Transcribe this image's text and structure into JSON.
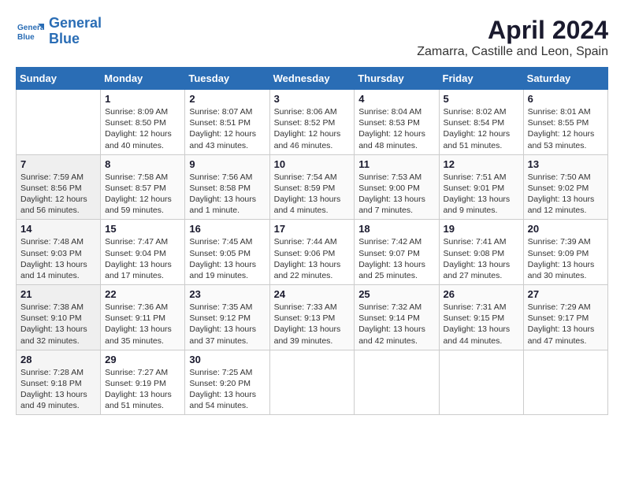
{
  "logo": {
    "line1": "General",
    "line2": "Blue"
  },
  "title": "April 2024",
  "subtitle": "Zamarra, Castille and Leon, Spain",
  "weekdays": [
    "Sunday",
    "Monday",
    "Tuesday",
    "Wednesday",
    "Thursday",
    "Friday",
    "Saturday"
  ],
  "weeks": [
    [
      {
        "day": "",
        "sunrise": "",
        "sunset": "",
        "daylight": ""
      },
      {
        "day": "1",
        "sunrise": "Sunrise: 8:09 AM",
        "sunset": "Sunset: 8:50 PM",
        "daylight": "Daylight: 12 hours and 40 minutes."
      },
      {
        "day": "2",
        "sunrise": "Sunrise: 8:07 AM",
        "sunset": "Sunset: 8:51 PM",
        "daylight": "Daylight: 12 hours and 43 minutes."
      },
      {
        "day": "3",
        "sunrise": "Sunrise: 8:06 AM",
        "sunset": "Sunset: 8:52 PM",
        "daylight": "Daylight: 12 hours and 46 minutes."
      },
      {
        "day": "4",
        "sunrise": "Sunrise: 8:04 AM",
        "sunset": "Sunset: 8:53 PM",
        "daylight": "Daylight: 12 hours and 48 minutes."
      },
      {
        "day": "5",
        "sunrise": "Sunrise: 8:02 AM",
        "sunset": "Sunset: 8:54 PM",
        "daylight": "Daylight: 12 hours and 51 minutes."
      },
      {
        "day": "6",
        "sunrise": "Sunrise: 8:01 AM",
        "sunset": "Sunset: 8:55 PM",
        "daylight": "Daylight: 12 hours and 53 minutes."
      }
    ],
    [
      {
        "day": "7",
        "sunrise": "Sunrise: 7:59 AM",
        "sunset": "Sunset: 8:56 PM",
        "daylight": "Daylight: 12 hours and 56 minutes."
      },
      {
        "day": "8",
        "sunrise": "Sunrise: 7:58 AM",
        "sunset": "Sunset: 8:57 PM",
        "daylight": "Daylight: 12 hours and 59 minutes."
      },
      {
        "day": "9",
        "sunrise": "Sunrise: 7:56 AM",
        "sunset": "Sunset: 8:58 PM",
        "daylight": "Daylight: 13 hours and 1 minute."
      },
      {
        "day": "10",
        "sunrise": "Sunrise: 7:54 AM",
        "sunset": "Sunset: 8:59 PM",
        "daylight": "Daylight: 13 hours and 4 minutes."
      },
      {
        "day": "11",
        "sunrise": "Sunrise: 7:53 AM",
        "sunset": "Sunset: 9:00 PM",
        "daylight": "Daylight: 13 hours and 7 minutes."
      },
      {
        "day": "12",
        "sunrise": "Sunrise: 7:51 AM",
        "sunset": "Sunset: 9:01 PM",
        "daylight": "Daylight: 13 hours and 9 minutes."
      },
      {
        "day": "13",
        "sunrise": "Sunrise: 7:50 AM",
        "sunset": "Sunset: 9:02 PM",
        "daylight": "Daylight: 13 hours and 12 minutes."
      }
    ],
    [
      {
        "day": "14",
        "sunrise": "Sunrise: 7:48 AM",
        "sunset": "Sunset: 9:03 PM",
        "daylight": "Daylight: 13 hours and 14 minutes."
      },
      {
        "day": "15",
        "sunrise": "Sunrise: 7:47 AM",
        "sunset": "Sunset: 9:04 PM",
        "daylight": "Daylight: 13 hours and 17 minutes."
      },
      {
        "day": "16",
        "sunrise": "Sunrise: 7:45 AM",
        "sunset": "Sunset: 9:05 PM",
        "daylight": "Daylight: 13 hours and 19 minutes."
      },
      {
        "day": "17",
        "sunrise": "Sunrise: 7:44 AM",
        "sunset": "Sunset: 9:06 PM",
        "daylight": "Daylight: 13 hours and 22 minutes."
      },
      {
        "day": "18",
        "sunrise": "Sunrise: 7:42 AM",
        "sunset": "Sunset: 9:07 PM",
        "daylight": "Daylight: 13 hours and 25 minutes."
      },
      {
        "day": "19",
        "sunrise": "Sunrise: 7:41 AM",
        "sunset": "Sunset: 9:08 PM",
        "daylight": "Daylight: 13 hours and 27 minutes."
      },
      {
        "day": "20",
        "sunrise": "Sunrise: 7:39 AM",
        "sunset": "Sunset: 9:09 PM",
        "daylight": "Daylight: 13 hours and 30 minutes."
      }
    ],
    [
      {
        "day": "21",
        "sunrise": "Sunrise: 7:38 AM",
        "sunset": "Sunset: 9:10 PM",
        "daylight": "Daylight: 13 hours and 32 minutes."
      },
      {
        "day": "22",
        "sunrise": "Sunrise: 7:36 AM",
        "sunset": "Sunset: 9:11 PM",
        "daylight": "Daylight: 13 hours and 35 minutes."
      },
      {
        "day": "23",
        "sunrise": "Sunrise: 7:35 AM",
        "sunset": "Sunset: 9:12 PM",
        "daylight": "Daylight: 13 hours and 37 minutes."
      },
      {
        "day": "24",
        "sunrise": "Sunrise: 7:33 AM",
        "sunset": "Sunset: 9:13 PM",
        "daylight": "Daylight: 13 hours and 39 minutes."
      },
      {
        "day": "25",
        "sunrise": "Sunrise: 7:32 AM",
        "sunset": "Sunset: 9:14 PM",
        "daylight": "Daylight: 13 hours and 42 minutes."
      },
      {
        "day": "26",
        "sunrise": "Sunrise: 7:31 AM",
        "sunset": "Sunset: 9:15 PM",
        "daylight": "Daylight: 13 hours and 44 minutes."
      },
      {
        "day": "27",
        "sunrise": "Sunrise: 7:29 AM",
        "sunset": "Sunset: 9:17 PM",
        "daylight": "Daylight: 13 hours and 47 minutes."
      }
    ],
    [
      {
        "day": "28",
        "sunrise": "Sunrise: 7:28 AM",
        "sunset": "Sunset: 9:18 PM",
        "daylight": "Daylight: 13 hours and 49 minutes."
      },
      {
        "day": "29",
        "sunrise": "Sunrise: 7:27 AM",
        "sunset": "Sunset: 9:19 PM",
        "daylight": "Daylight: 13 hours and 51 minutes."
      },
      {
        "day": "30",
        "sunrise": "Sunrise: 7:25 AM",
        "sunset": "Sunset: 9:20 PM",
        "daylight": "Daylight: 13 hours and 54 minutes."
      },
      {
        "day": "",
        "sunrise": "",
        "sunset": "",
        "daylight": ""
      },
      {
        "day": "",
        "sunrise": "",
        "sunset": "",
        "daylight": ""
      },
      {
        "day": "",
        "sunrise": "",
        "sunset": "",
        "daylight": ""
      },
      {
        "day": "",
        "sunrise": "",
        "sunset": "",
        "daylight": ""
      }
    ]
  ]
}
